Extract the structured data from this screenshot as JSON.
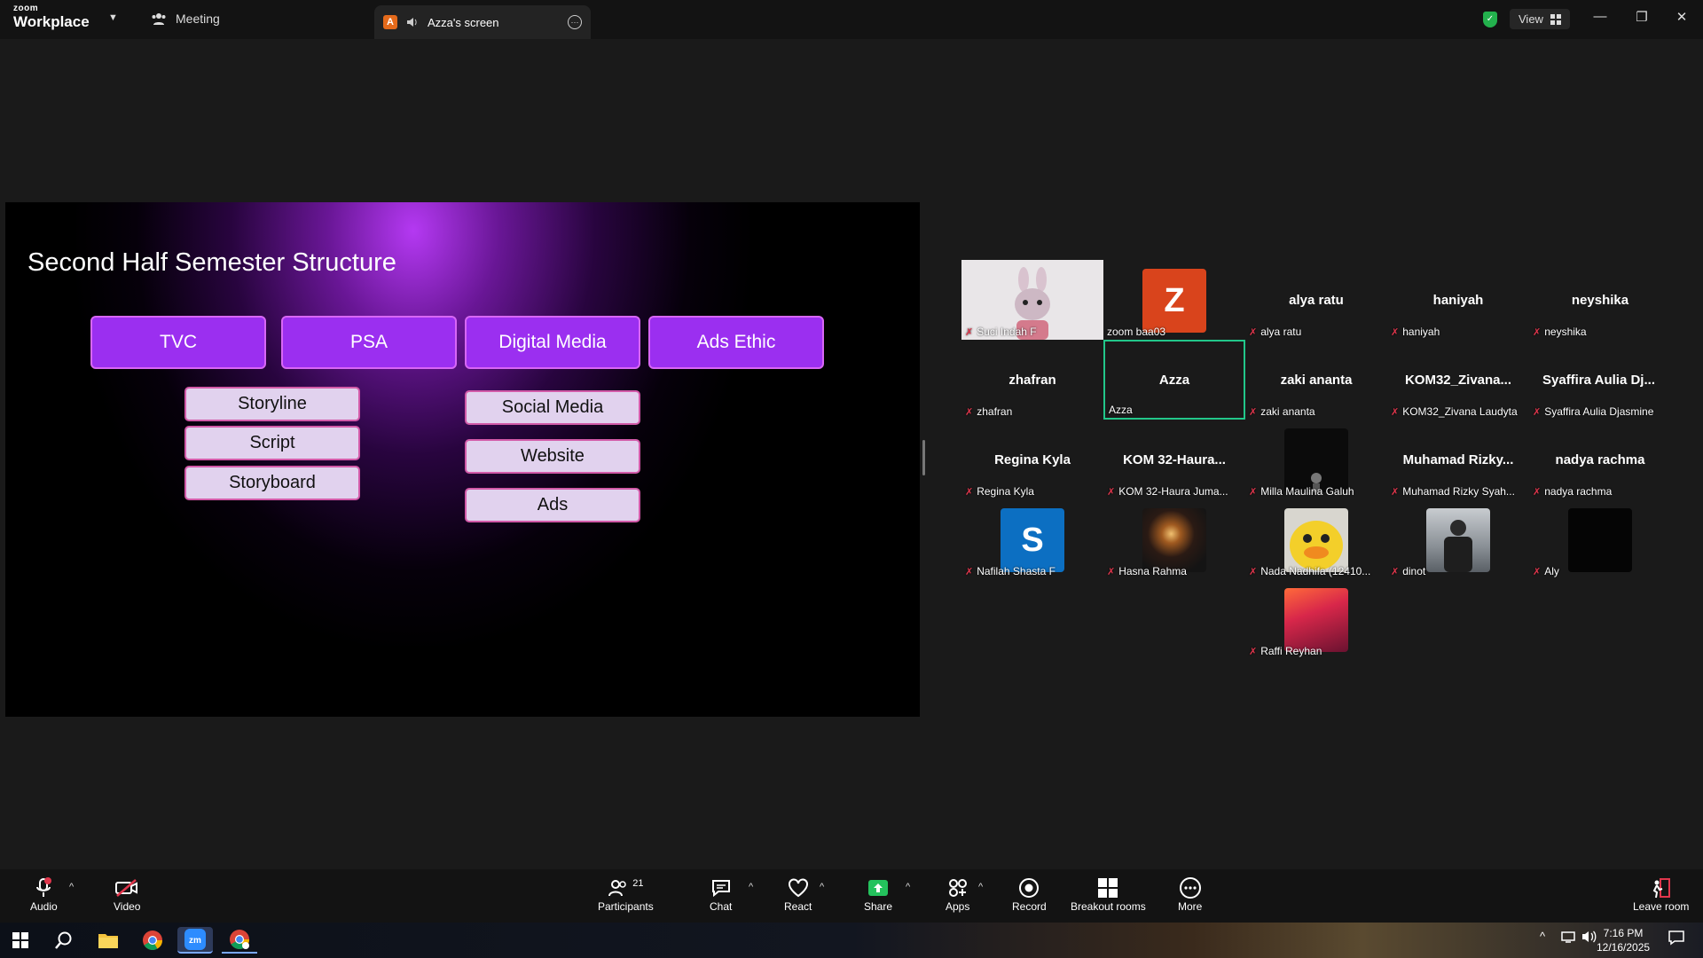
{
  "titlebar": {
    "logo_small": "zoom",
    "logo_main": "Workplace",
    "meeting_tab": "Meeting",
    "screen_tab": "Azza's screen",
    "screen_tab_avatar": "A",
    "view_label": "View"
  },
  "slide": {
    "title": "Second Half Semester Structure",
    "categories": [
      "TVC",
      "PSA",
      "Digital Media",
      "Ads Ethic"
    ],
    "tvc_items": [
      "Storyline",
      "Script",
      "Storyboard"
    ],
    "digital_items": [
      "Social Media",
      "Website",
      "Ads"
    ]
  },
  "participants": [
    {
      "name": "",
      "label": "Suci Indah F",
      "type": "video-bunny"
    },
    {
      "name": "",
      "label": "zoom baa03",
      "type": "avatar",
      "letter": "Z",
      "color": "#d9441c"
    },
    {
      "name": "alya ratu",
      "label": "alya ratu"
    },
    {
      "name": "haniyah",
      "label": "haniyah"
    },
    {
      "name": "neyshika",
      "label": "neyshika"
    },
    {
      "name": "zhafran",
      "label": "zhafran"
    },
    {
      "name": "Azza",
      "label": "Azza",
      "active": true
    },
    {
      "name": "zaki ananta",
      "label": "zaki ananta"
    },
    {
      "name": "KOM32_Zivana...",
      "label": "KOM32_Zivana Laudyta"
    },
    {
      "name": "Syaffira  Aulia  Dj...",
      "label": "Syaffira Aulia Djasmine"
    },
    {
      "name": "Regina Kyla",
      "label": "Regina Kyla"
    },
    {
      "name": "KOM  32-Haura...",
      "label": "KOM 32-Haura Juma..."
    },
    {
      "name": "",
      "label": "Milla Maulina Galuh",
      "type": "photo-dark"
    },
    {
      "name": "Muhamad  Rizky...",
      "label": "Muhamad Rizky Syah..."
    },
    {
      "name": "nadya rachma",
      "label": "nadya rachma"
    },
    {
      "name": "",
      "label": "Nafilah Shasta F",
      "type": "avatar",
      "letter": "S",
      "color": "#0c6fc2"
    },
    {
      "name": "",
      "label": "Hasna Rahma",
      "type": "photo-night"
    },
    {
      "name": "",
      "label": "Nada Nadhifa (12410...",
      "type": "photo-duck"
    },
    {
      "name": "",
      "label": "dinot",
      "type": "photo-person"
    },
    {
      "name": "",
      "label": "Aly",
      "type": "photo-black"
    },
    {
      "name": "",
      "label": "Raffi Reyhan",
      "type": "photo-red"
    }
  ],
  "toolbar": {
    "audio": "Audio",
    "video": "Video",
    "participants": "Participants",
    "participants_count": "21",
    "chat": "Chat",
    "react": "React",
    "share": "Share",
    "apps": "Apps",
    "record": "Record",
    "breakout": "Breakout rooms",
    "more": "More",
    "leave": "Leave room"
  },
  "taskbar": {
    "time": "7:16 PM",
    "date": "12/16/2025"
  },
  "colors": {
    "active_speaker": "#22c78a",
    "muted_mic": "#e0364c",
    "share_green": "#24c25d",
    "category_box": "#9b2ff0",
    "item_box": "#e1d2ee"
  }
}
